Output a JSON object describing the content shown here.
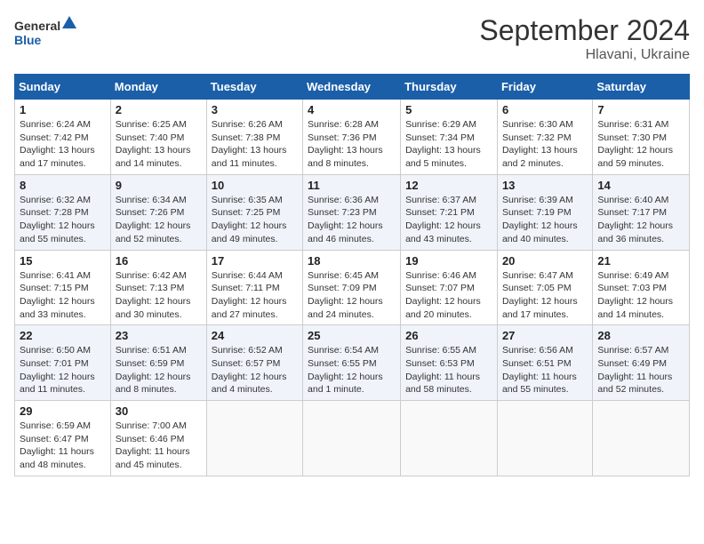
{
  "header": {
    "logo_line1": "General",
    "logo_line2": "Blue",
    "month": "September 2024",
    "location": "Hlavani, Ukraine"
  },
  "weekdays": [
    "Sunday",
    "Monday",
    "Tuesday",
    "Wednesday",
    "Thursday",
    "Friday",
    "Saturday"
  ],
  "weeks": [
    [
      {
        "day": "1",
        "info": "Sunrise: 6:24 AM\nSunset: 7:42 PM\nDaylight: 13 hours and 17 minutes."
      },
      {
        "day": "2",
        "info": "Sunrise: 6:25 AM\nSunset: 7:40 PM\nDaylight: 13 hours and 14 minutes."
      },
      {
        "day": "3",
        "info": "Sunrise: 6:26 AM\nSunset: 7:38 PM\nDaylight: 13 hours and 11 minutes."
      },
      {
        "day": "4",
        "info": "Sunrise: 6:28 AM\nSunset: 7:36 PM\nDaylight: 13 hours and 8 minutes."
      },
      {
        "day": "5",
        "info": "Sunrise: 6:29 AM\nSunset: 7:34 PM\nDaylight: 13 hours and 5 minutes."
      },
      {
        "day": "6",
        "info": "Sunrise: 6:30 AM\nSunset: 7:32 PM\nDaylight: 13 hours and 2 minutes."
      },
      {
        "day": "7",
        "info": "Sunrise: 6:31 AM\nSunset: 7:30 PM\nDaylight: 12 hours and 59 minutes."
      }
    ],
    [
      {
        "day": "8",
        "info": "Sunrise: 6:32 AM\nSunset: 7:28 PM\nDaylight: 12 hours and 55 minutes."
      },
      {
        "day": "9",
        "info": "Sunrise: 6:34 AM\nSunset: 7:26 PM\nDaylight: 12 hours and 52 minutes."
      },
      {
        "day": "10",
        "info": "Sunrise: 6:35 AM\nSunset: 7:25 PM\nDaylight: 12 hours and 49 minutes."
      },
      {
        "day": "11",
        "info": "Sunrise: 6:36 AM\nSunset: 7:23 PM\nDaylight: 12 hours and 46 minutes."
      },
      {
        "day": "12",
        "info": "Sunrise: 6:37 AM\nSunset: 7:21 PM\nDaylight: 12 hours and 43 minutes."
      },
      {
        "day": "13",
        "info": "Sunrise: 6:39 AM\nSunset: 7:19 PM\nDaylight: 12 hours and 40 minutes."
      },
      {
        "day": "14",
        "info": "Sunrise: 6:40 AM\nSunset: 7:17 PM\nDaylight: 12 hours and 36 minutes."
      }
    ],
    [
      {
        "day": "15",
        "info": "Sunrise: 6:41 AM\nSunset: 7:15 PM\nDaylight: 12 hours and 33 minutes."
      },
      {
        "day": "16",
        "info": "Sunrise: 6:42 AM\nSunset: 7:13 PM\nDaylight: 12 hours and 30 minutes."
      },
      {
        "day": "17",
        "info": "Sunrise: 6:44 AM\nSunset: 7:11 PM\nDaylight: 12 hours and 27 minutes."
      },
      {
        "day": "18",
        "info": "Sunrise: 6:45 AM\nSunset: 7:09 PM\nDaylight: 12 hours and 24 minutes."
      },
      {
        "day": "19",
        "info": "Sunrise: 6:46 AM\nSunset: 7:07 PM\nDaylight: 12 hours and 20 minutes."
      },
      {
        "day": "20",
        "info": "Sunrise: 6:47 AM\nSunset: 7:05 PM\nDaylight: 12 hours and 17 minutes."
      },
      {
        "day": "21",
        "info": "Sunrise: 6:49 AM\nSunset: 7:03 PM\nDaylight: 12 hours and 14 minutes."
      }
    ],
    [
      {
        "day": "22",
        "info": "Sunrise: 6:50 AM\nSunset: 7:01 PM\nDaylight: 12 hours and 11 minutes."
      },
      {
        "day": "23",
        "info": "Sunrise: 6:51 AM\nSunset: 6:59 PM\nDaylight: 12 hours and 8 minutes."
      },
      {
        "day": "24",
        "info": "Sunrise: 6:52 AM\nSunset: 6:57 PM\nDaylight: 12 hours and 4 minutes."
      },
      {
        "day": "25",
        "info": "Sunrise: 6:54 AM\nSunset: 6:55 PM\nDaylight: 12 hours and 1 minute."
      },
      {
        "day": "26",
        "info": "Sunrise: 6:55 AM\nSunset: 6:53 PM\nDaylight: 11 hours and 58 minutes."
      },
      {
        "day": "27",
        "info": "Sunrise: 6:56 AM\nSunset: 6:51 PM\nDaylight: 11 hours and 55 minutes."
      },
      {
        "day": "28",
        "info": "Sunrise: 6:57 AM\nSunset: 6:49 PM\nDaylight: 11 hours and 52 minutes."
      }
    ],
    [
      {
        "day": "29",
        "info": "Sunrise: 6:59 AM\nSunset: 6:47 PM\nDaylight: 11 hours and 48 minutes."
      },
      {
        "day": "30",
        "info": "Sunrise: 7:00 AM\nSunset: 6:46 PM\nDaylight: 11 hours and 45 minutes."
      },
      {
        "day": "",
        "info": ""
      },
      {
        "day": "",
        "info": ""
      },
      {
        "day": "",
        "info": ""
      },
      {
        "day": "",
        "info": ""
      },
      {
        "day": "",
        "info": ""
      }
    ]
  ]
}
